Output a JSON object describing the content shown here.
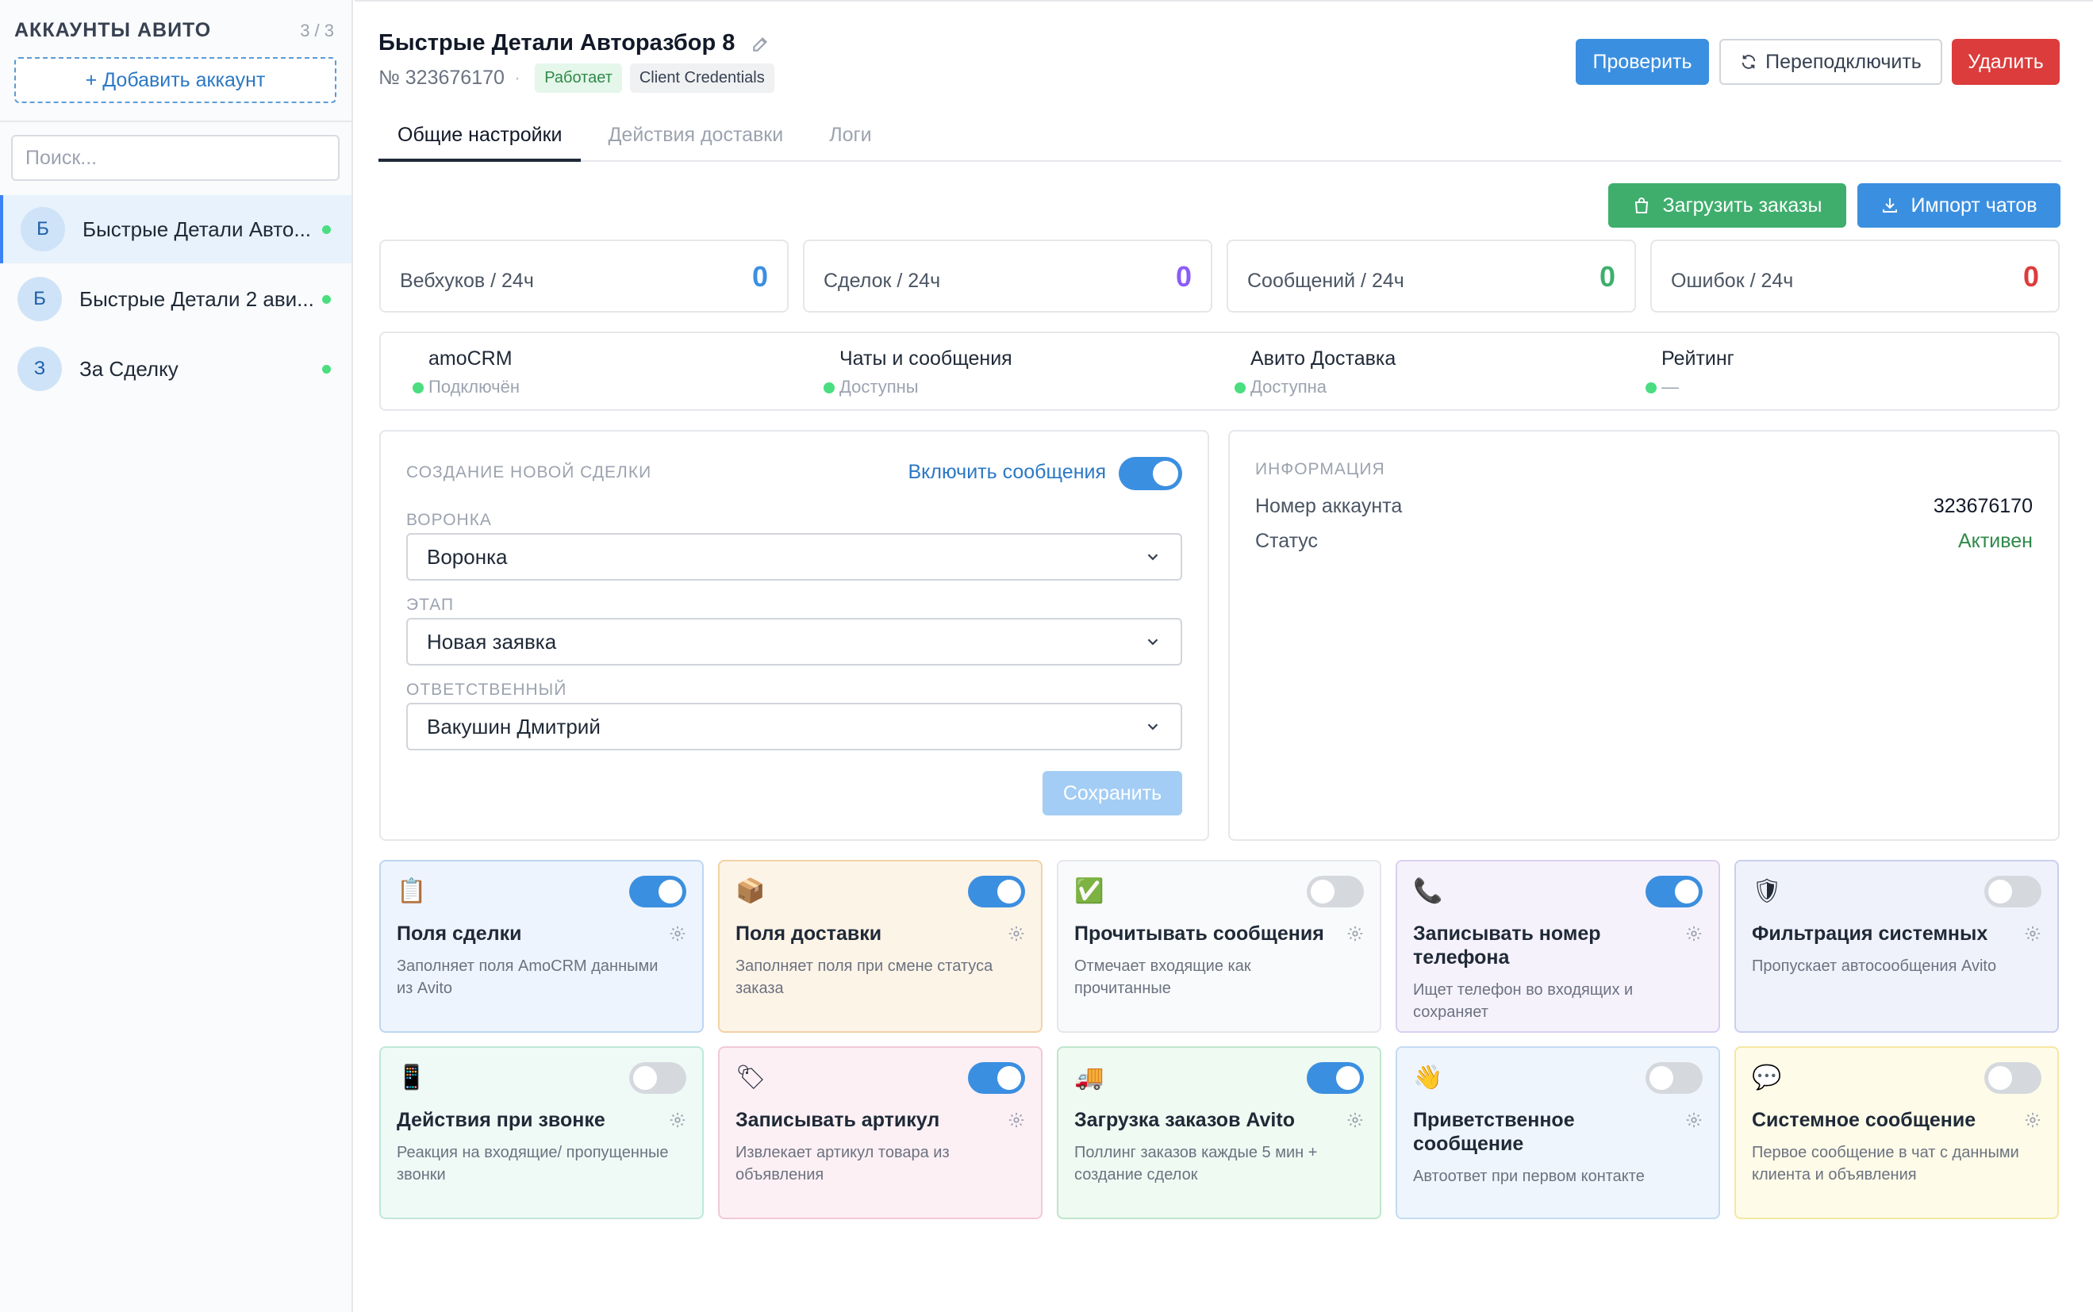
{
  "sidebar": {
    "title": "АККАУНТЫ АВИТО",
    "count": "3 / 3",
    "add_label": "+ Добавить аккаунт",
    "search_placeholder": "Поиск...",
    "accounts": [
      {
        "initial": "Б",
        "name": "Быстрые Детали Авто...",
        "active": true
      },
      {
        "initial": "Б",
        "name": "Быстрые Детали 2 ави...",
        "active": false
      },
      {
        "initial": "З",
        "name": "За Сделку",
        "active": false
      }
    ]
  },
  "header": {
    "title": "Быстрые Детали Авторазбор 8",
    "number": "№ 323676170",
    "separator": "·",
    "status_badge": "Работает",
    "auth_badge": "Client Credentials",
    "check_label": "Проверить",
    "reconnect_label": "Переподключить",
    "delete_label": "Удалить"
  },
  "tabs": [
    "Общие настройки",
    "Действия доставки",
    "Логи"
  ],
  "actions": {
    "load_orders": "Загрузить заказы",
    "import_chats": "Импорт чатов"
  },
  "stats": [
    {
      "label": "Вебхуков / 24ч",
      "value": "0",
      "color": "#3b8fe0"
    },
    {
      "label": "Сделок / 24ч",
      "value": "0",
      "color": "#8b5cf6"
    },
    {
      "label": "Сообщений / 24ч",
      "value": "0",
      "color": "#3fae6d"
    },
    {
      "label": "Ошибок / 24ч",
      "value": "0",
      "color": "#dc3c3c"
    }
  ],
  "integrations": [
    {
      "name": "amoCRM",
      "status": "Подключён"
    },
    {
      "name": "Чаты и сообщения",
      "status": "Доступны"
    },
    {
      "name": "Авито Доставка",
      "status": "Доступна"
    },
    {
      "name": "Рейтинг",
      "status": "—"
    }
  ],
  "create_deal": {
    "title": "СОЗДАНИЕ НОВОЙ СДЕЛКИ",
    "toggle_label": "Включить сообщения",
    "toggle_on": true,
    "pipeline_label": "ВОРОНКА",
    "pipeline_value": "Воронка",
    "stage_label": "ЭТАП",
    "stage_value": "Новая заявка",
    "responsible_label": "ОТВЕТСТВЕННЫЙ",
    "responsible_value": "Вакушин Дмитрий",
    "save_label": "Сохранить"
  },
  "info": {
    "title": "ИНФОРМАЦИЯ",
    "account_number_label": "Номер аккаунта",
    "account_number_value": "323676170",
    "status_label": "Статус",
    "status_value": "Активен"
  },
  "features": [
    {
      "icon": "clipboard-icon",
      "glyph": "📋",
      "title": "Поля сделки",
      "desc": "Заполняет поля AmoCRM данными из Avito",
      "on": true,
      "bg": "#eef4fd",
      "border": "#bcd6f3"
    },
    {
      "icon": "package-icon",
      "glyph": "📦",
      "title": "Поля доставки",
      "desc": "Заполняет поля при смене статуса заказа",
      "on": true,
      "bg": "#fdf4e8",
      "border": "#f3d2a5"
    },
    {
      "icon": "check-mark-icon",
      "glyph": "✅",
      "title": "Прочитывать сообщения",
      "desc": "Отмечает входящие как прочитанные",
      "on": false,
      "bg": "#f9fafb",
      "border": "#e5e7eb"
    },
    {
      "icon": "phone-icon",
      "glyph": "📞",
      "title": "Записывать номер телефона",
      "desc": "Ищет телефон во входящих и сохраняет",
      "on": true,
      "bg": "#f6f2fc",
      "border": "#dccff1"
    },
    {
      "icon": "shield-icon",
      "glyph": "🛡",
      "title": "Фильтрация системных",
      "desc": "Пропускает автосообщения Avito",
      "on": false,
      "bg": "#f0f2fb",
      "border": "#c9cfee"
    },
    {
      "icon": "mobile-phone-icon",
      "glyph": "📱",
      "title": "Действия при звонке",
      "desc": "Реакция на входящие/ пропущенные звонки",
      "on": false,
      "bg": "#effaf6",
      "border": "#bfe8d6"
    },
    {
      "icon": "tag-icon",
      "glyph": "🏷",
      "title": "Записывать артикул",
      "desc": "Извлекает артикул товара из объявления",
      "on": true,
      "bg": "#fdf0f4",
      "border": "#f2c9d6"
    },
    {
      "icon": "truck-icon",
      "glyph": "🚚",
      "title": "Загрузка заказов Avito",
      "desc": "Поллинг заказов каждые 5 мин + создание сделок",
      "on": true,
      "bg": "#eefaf2",
      "border": "#bfe6cc"
    },
    {
      "icon": "waving-hand-icon",
      "glyph": "👋",
      "title": "Приветственное сообщение",
      "desc": "Автоответ при первом контакте",
      "on": false,
      "bg": "#eef5fc",
      "border": "#c4dbf2"
    },
    {
      "icon": "speech-bubble-icon",
      "glyph": "💬",
      "title": "Системное сообщение",
      "desc": "Первое сообщение в чат с данными клиента и объявления",
      "on": false,
      "bg": "#fefbe8",
      "border": "#f5e7a3"
    }
  ]
}
